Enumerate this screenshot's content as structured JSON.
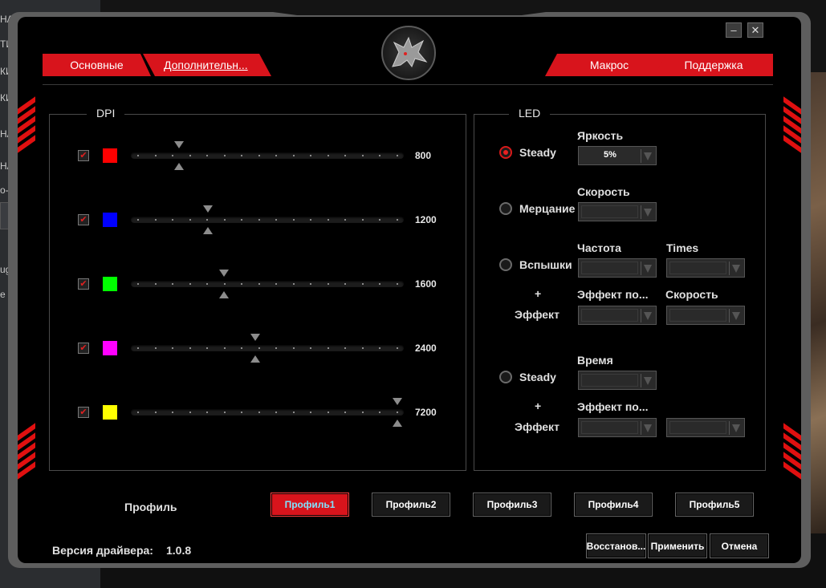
{
  "background": {
    "left_fragments": [
      "НА",
      "ТИ",
      "КИ",
      "КИ",
      "НА",
      "НА",
      "о-до",
      "х",
      "uga",
      "е"
    ]
  },
  "window": {
    "minimize_label": "–",
    "close_label": "✕",
    "logo_icon": "dragon-logo-icon"
  },
  "tabs": {
    "main": "Основные",
    "advanced": "Дополнительн...",
    "macro": "Макрос",
    "support": "Поддержка"
  },
  "dpi": {
    "title": "DPI",
    "levels": [
      {
        "checked": true,
        "color": "#ff0000",
        "value": "800",
        "level": 0.1
      },
      {
        "checked": true,
        "color": "#0000ff",
        "value": "1200",
        "level": 0.22
      },
      {
        "checked": true,
        "color": "#00ff00",
        "value": "1600",
        "level": 0.285
      },
      {
        "checked": true,
        "color": "#ff00ff",
        "value": "2400",
        "level": 0.415
      },
      {
        "checked": true,
        "color": "#ffff00",
        "value": "7200",
        "level": 1.0
      }
    ]
  },
  "led": {
    "title": "LED",
    "brightness_label": "Яркость",
    "brightness_value": "5%",
    "steady_label": "Steady",
    "speed_label": "Скорость",
    "flicker_label": "Мерцание",
    "frequency_label": "Частота",
    "times_label": "Times",
    "flash_label": "Вспышки",
    "plus": "+",
    "effect_label": "Эффект",
    "effect_trans_label": "Эффект по...",
    "speed2_label": "Скорость",
    "time_label": "Время",
    "steady2_label": "Steady",
    "plus2": "+",
    "effect2_label": "Эффект",
    "effect_trans2_label": "Эффект по..."
  },
  "profile": {
    "label": "Профиль",
    "buttons": [
      "Профиль1",
      "Профиль2",
      "Профиль3",
      "Профиль4",
      "Профиль5"
    ],
    "active_index": 0
  },
  "footer": {
    "version_label": "Версия драйвера:",
    "version_value": "1.0.8",
    "restore": "Восстанов...",
    "apply": "Применить",
    "cancel": "Отмена"
  }
}
